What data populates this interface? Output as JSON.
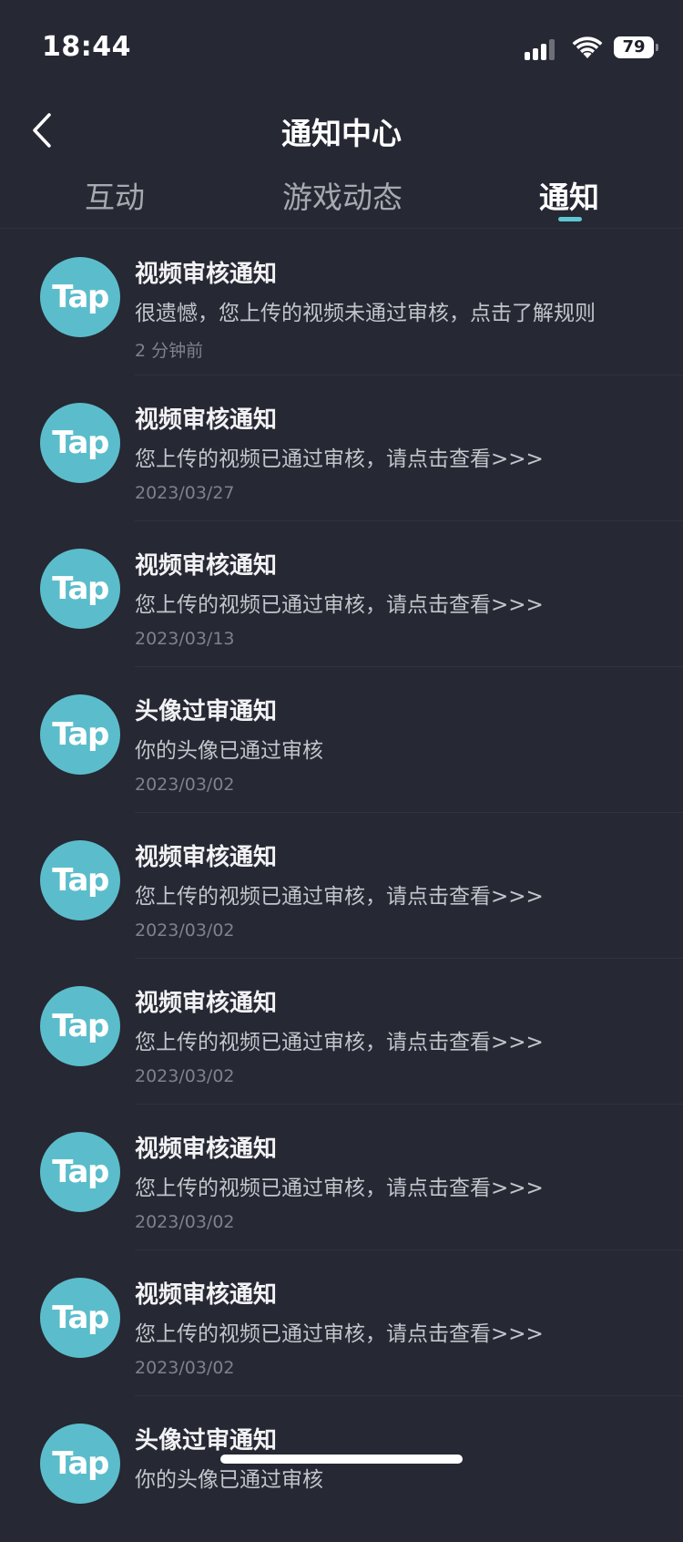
{
  "status_bar": {
    "time": "18:44",
    "battery": "79",
    "icons": [
      "signal-icon",
      "wifi-icon",
      "battery-icon"
    ]
  },
  "header": {
    "back_icon": "chevron-left-icon",
    "title": "通知中心"
  },
  "tabs": [
    {
      "label": "互动",
      "active": false
    },
    {
      "label": "游戏动态",
      "active": false
    },
    {
      "label": "通知",
      "active": true
    }
  ],
  "notifications": [
    {
      "avatar": "Tap",
      "title": "视频审核通知",
      "body": "很遗憾，您上传的视频未通过审核，点击了解规则",
      "time": "2 分钟前"
    },
    {
      "avatar": "Tap",
      "title": "视频审核通知",
      "body": "您上传的视频已通过审核，请点击查看>>>",
      "time": "2023/03/27"
    },
    {
      "avatar": "Tap",
      "title": "视频审核通知",
      "body": "您上传的视频已通过审核，请点击查看>>>",
      "time": "2023/03/13"
    },
    {
      "avatar": "Tap",
      "title": "头像过审通知",
      "body": "你的头像已通过审核",
      "time": "2023/03/02"
    },
    {
      "avatar": "Tap",
      "title": "视频审核通知",
      "body": "您上传的视频已通过审核，请点击查看>>>",
      "time": "2023/03/02"
    },
    {
      "avatar": "Tap",
      "title": "视频审核通知",
      "body": "您上传的视频已通过审核，请点击查看>>>",
      "time": "2023/03/02"
    },
    {
      "avatar": "Tap",
      "title": "视频审核通知",
      "body": "您上传的视频已通过审核，请点击查看>>>",
      "time": "2023/03/02"
    },
    {
      "avatar": "Tap",
      "title": "视频审核通知",
      "body": "您上传的视频已通过审核，请点击查看>>>",
      "time": "2023/03/02"
    },
    {
      "avatar": "Tap",
      "title": "头像过审通知",
      "body": "你的头像已通过审核",
      "time": ""
    }
  ],
  "colors": {
    "background": "#262833",
    "accent": "#5fc6d3",
    "avatar": "#5bbdcb",
    "divider": "#30323d"
  }
}
